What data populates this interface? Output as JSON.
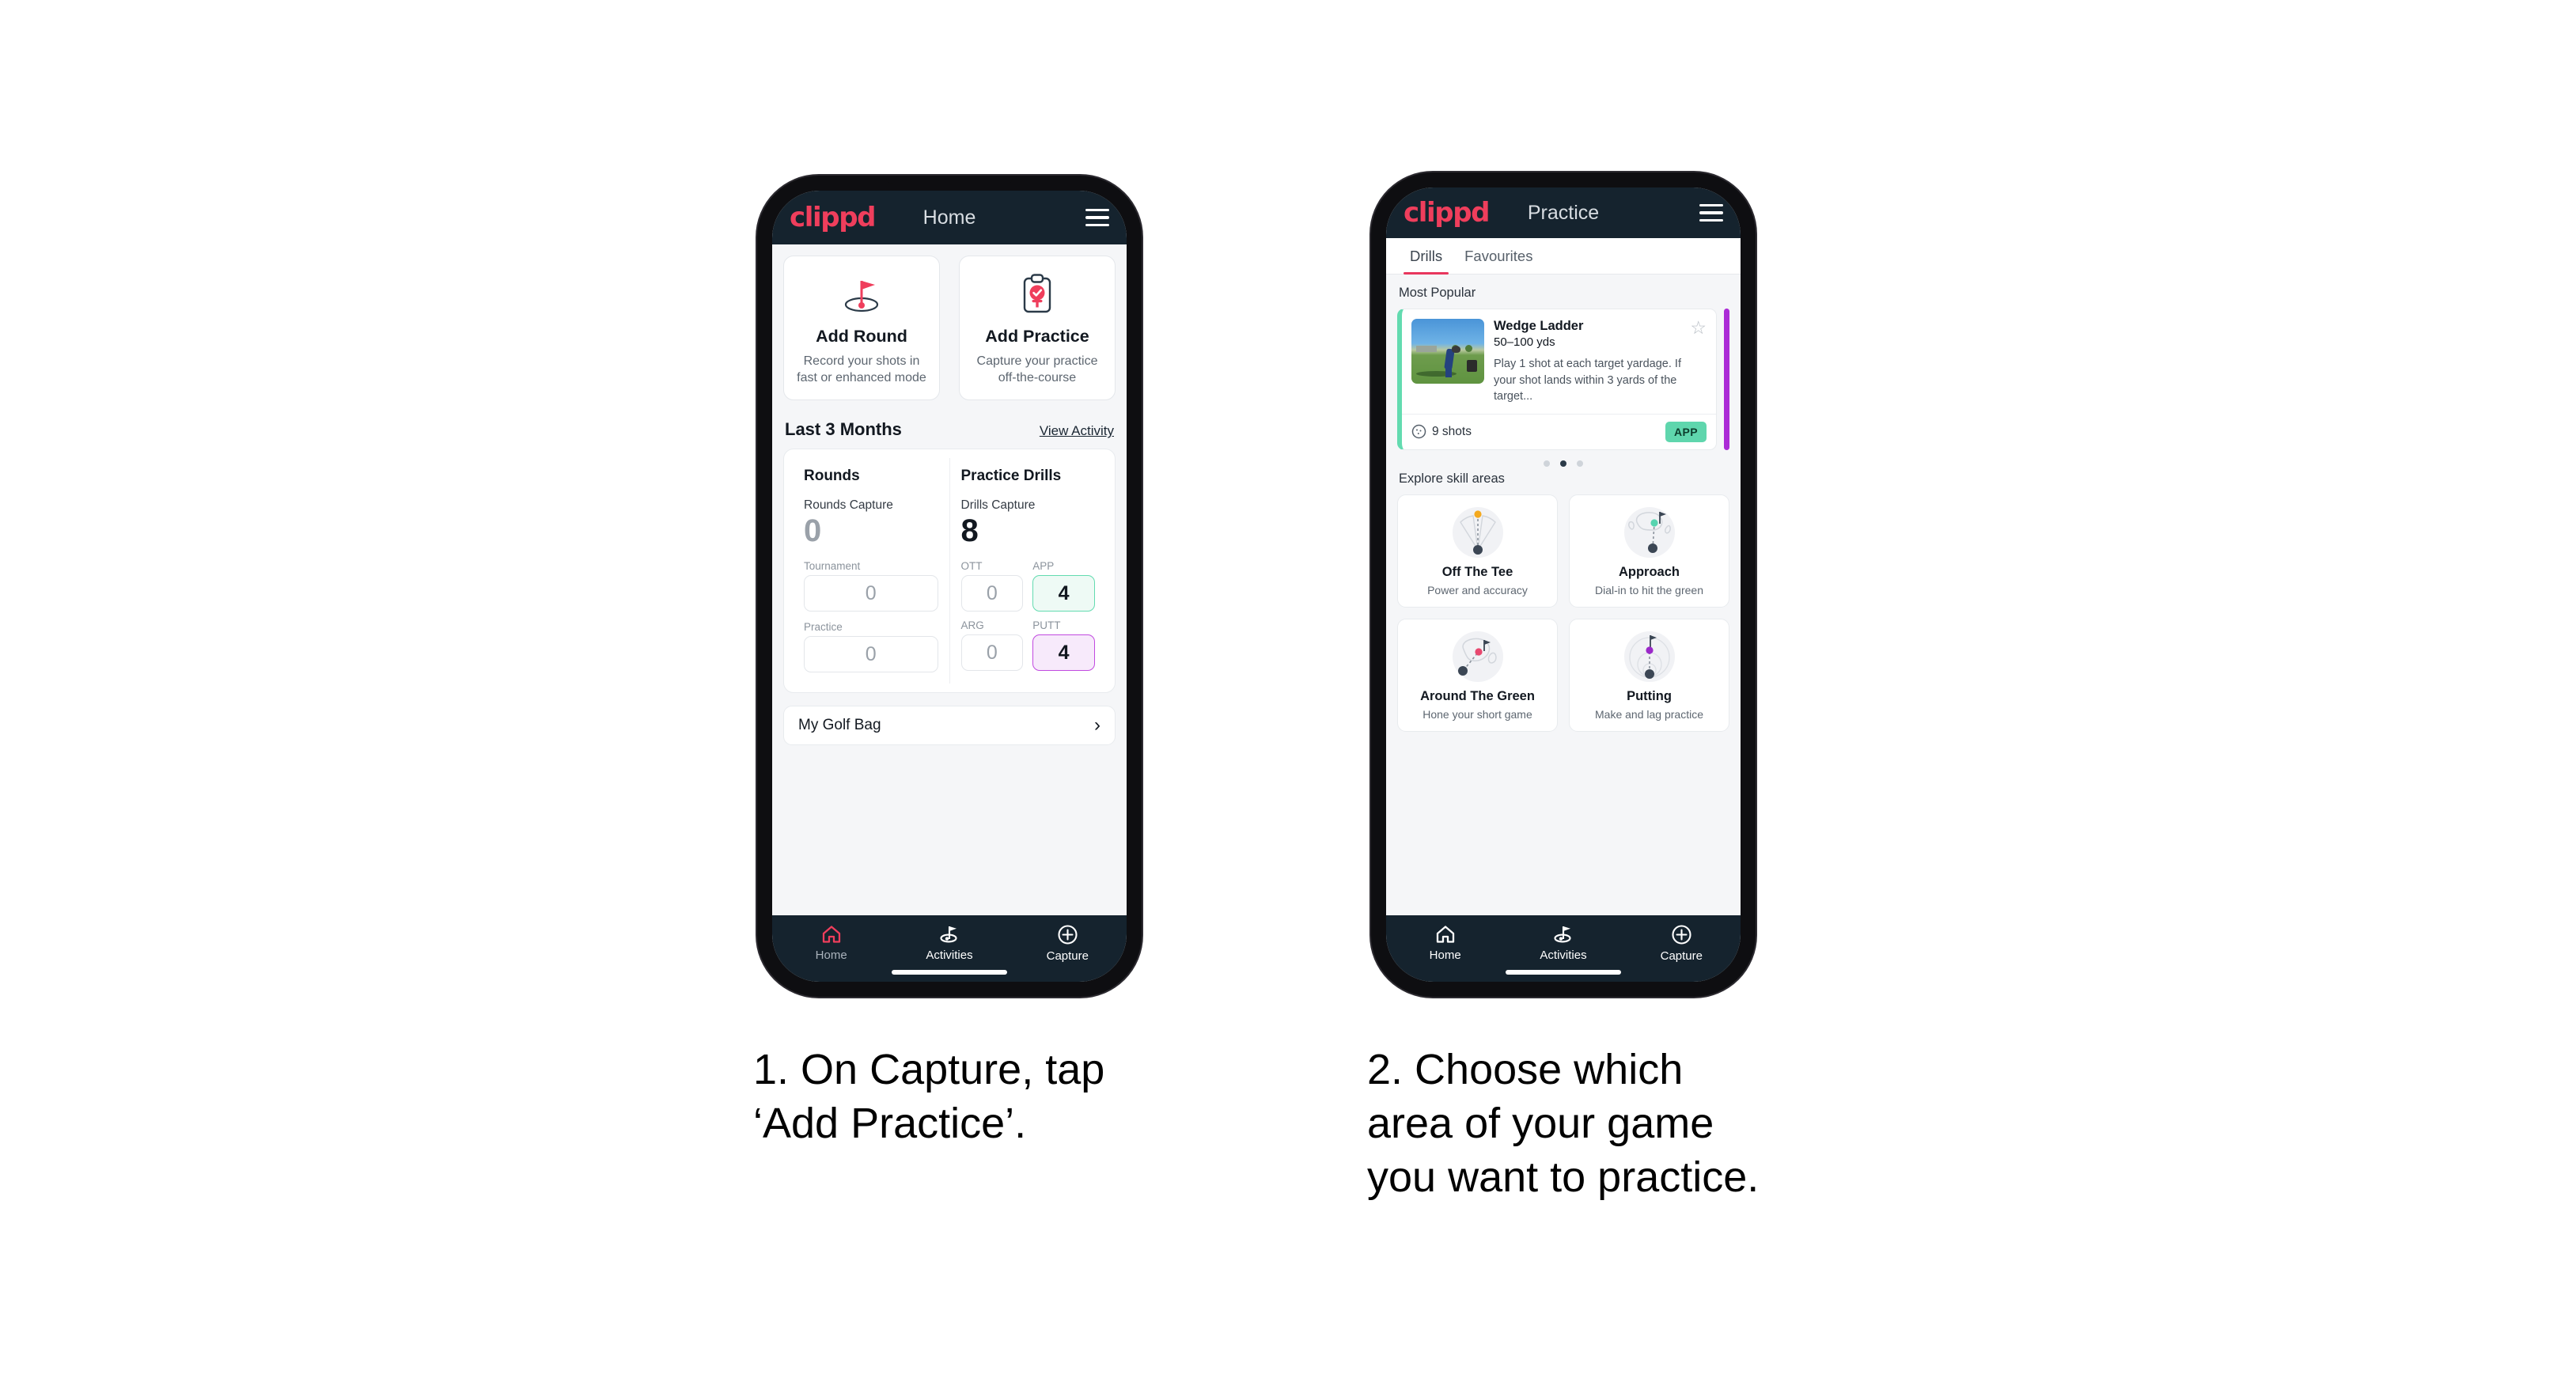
{
  "phone1": {
    "appbar": {
      "logo": "clippd",
      "title": "Home",
      "menu_icon": "hamburger-icon"
    },
    "actions": [
      {
        "icon": "golf-flag-icon",
        "title": "Add Round",
        "subtitle": "Record your shots in fast or enhanced mode"
      },
      {
        "icon": "clipboard-check-icon",
        "title": "Add Practice",
        "subtitle": "Capture your practice off-the-course"
      }
    ],
    "section": {
      "title": "Last 3 Months",
      "link": "View Activity"
    },
    "rounds": {
      "heading": "Rounds",
      "capture_label": "Rounds Capture",
      "capture_value": "0",
      "items": [
        {
          "label": "Tournament",
          "value": "0",
          "highlight": "none"
        },
        {
          "label": "Practice",
          "value": "0",
          "highlight": "none"
        }
      ]
    },
    "drills": {
      "heading": "Practice Drills",
      "capture_label": "Drills Capture",
      "capture_value": "8",
      "items": [
        {
          "label": "OTT",
          "value": "0",
          "highlight": "none"
        },
        {
          "label": "APP",
          "value": "4",
          "highlight": "app"
        },
        {
          "label": "ARG",
          "value": "0",
          "highlight": "none"
        },
        {
          "label": "PUTT",
          "value": "4",
          "highlight": "putt"
        }
      ]
    },
    "golf_bag": {
      "label": "My Golf Bag",
      "chevron": "chevron-right-icon"
    },
    "nav": [
      {
        "icon": "home-icon",
        "label": "Home",
        "active_icon": true,
        "active_label": false
      },
      {
        "icon": "golf-flag-icon",
        "label": "Activities",
        "active_icon": false,
        "active_label": true
      },
      {
        "icon": "plus-circle-icon",
        "label": "Capture",
        "active_icon": false,
        "active_label": true
      }
    ]
  },
  "phone2": {
    "appbar": {
      "logo": "clippd",
      "title": "Practice",
      "menu_icon": "hamburger-icon"
    },
    "tabs": [
      {
        "label": "Drills",
        "active": true
      },
      {
        "label": "Favourites",
        "active": false
      }
    ],
    "most_popular_heading": "Most Popular",
    "drill": {
      "name": "Wedge Ladder",
      "yardage": "50–100 yds",
      "description": "Play 1 shot at each target yardage. If your shot lands within 3 yards of the target...",
      "shots": "9 shots",
      "shots_icon": "golf-ball-icon",
      "tag": "APP",
      "star_icon": "star-outline-icon",
      "accent_color": "#63dbb0",
      "next_card_color": "#ab2bd6"
    },
    "carousel_dots": {
      "count": 3,
      "active_index": 1
    },
    "skill_heading": "Explore skill areas",
    "skills": [
      {
        "icon": "tee-shot-fan-icon",
        "title": "Off The Tee",
        "subtitle": "Power and accuracy",
        "dot_color": "#f4a91f"
      },
      {
        "icon": "approach-green-icon",
        "title": "Approach",
        "subtitle": "Dial-in to hit the green",
        "dot_color": "#56d4b0"
      },
      {
        "icon": "around-green-icon",
        "title": "Around The Green",
        "subtitle": "Hone your short game",
        "dot_color": "#e8486f"
      },
      {
        "icon": "putting-rings-icon",
        "title": "Putting",
        "subtitle": "Make and lag practice",
        "dot_color": "#9b28c9"
      }
    ],
    "nav": [
      {
        "icon": "home-icon",
        "label": "Home",
        "active_icon": false,
        "active_label": true
      },
      {
        "icon": "golf-flag-icon",
        "label": "Activities",
        "active_icon": false,
        "active_label": true
      },
      {
        "icon": "plus-circle-icon",
        "label": "Capture",
        "active_icon": false,
        "active_label": true
      }
    ]
  },
  "captions": {
    "step1": "1. On Capture, tap\n‘Add Practice’.",
    "step2": "2. Choose which\narea of your game\nyou want to practice."
  },
  "colors": {
    "brand_pink": "#ef3e5c",
    "appbar_dark": "#15232e",
    "app_green": "#63dbb0",
    "putt_purple": "#c14ae0",
    "tab_underline": "#e8365d"
  }
}
